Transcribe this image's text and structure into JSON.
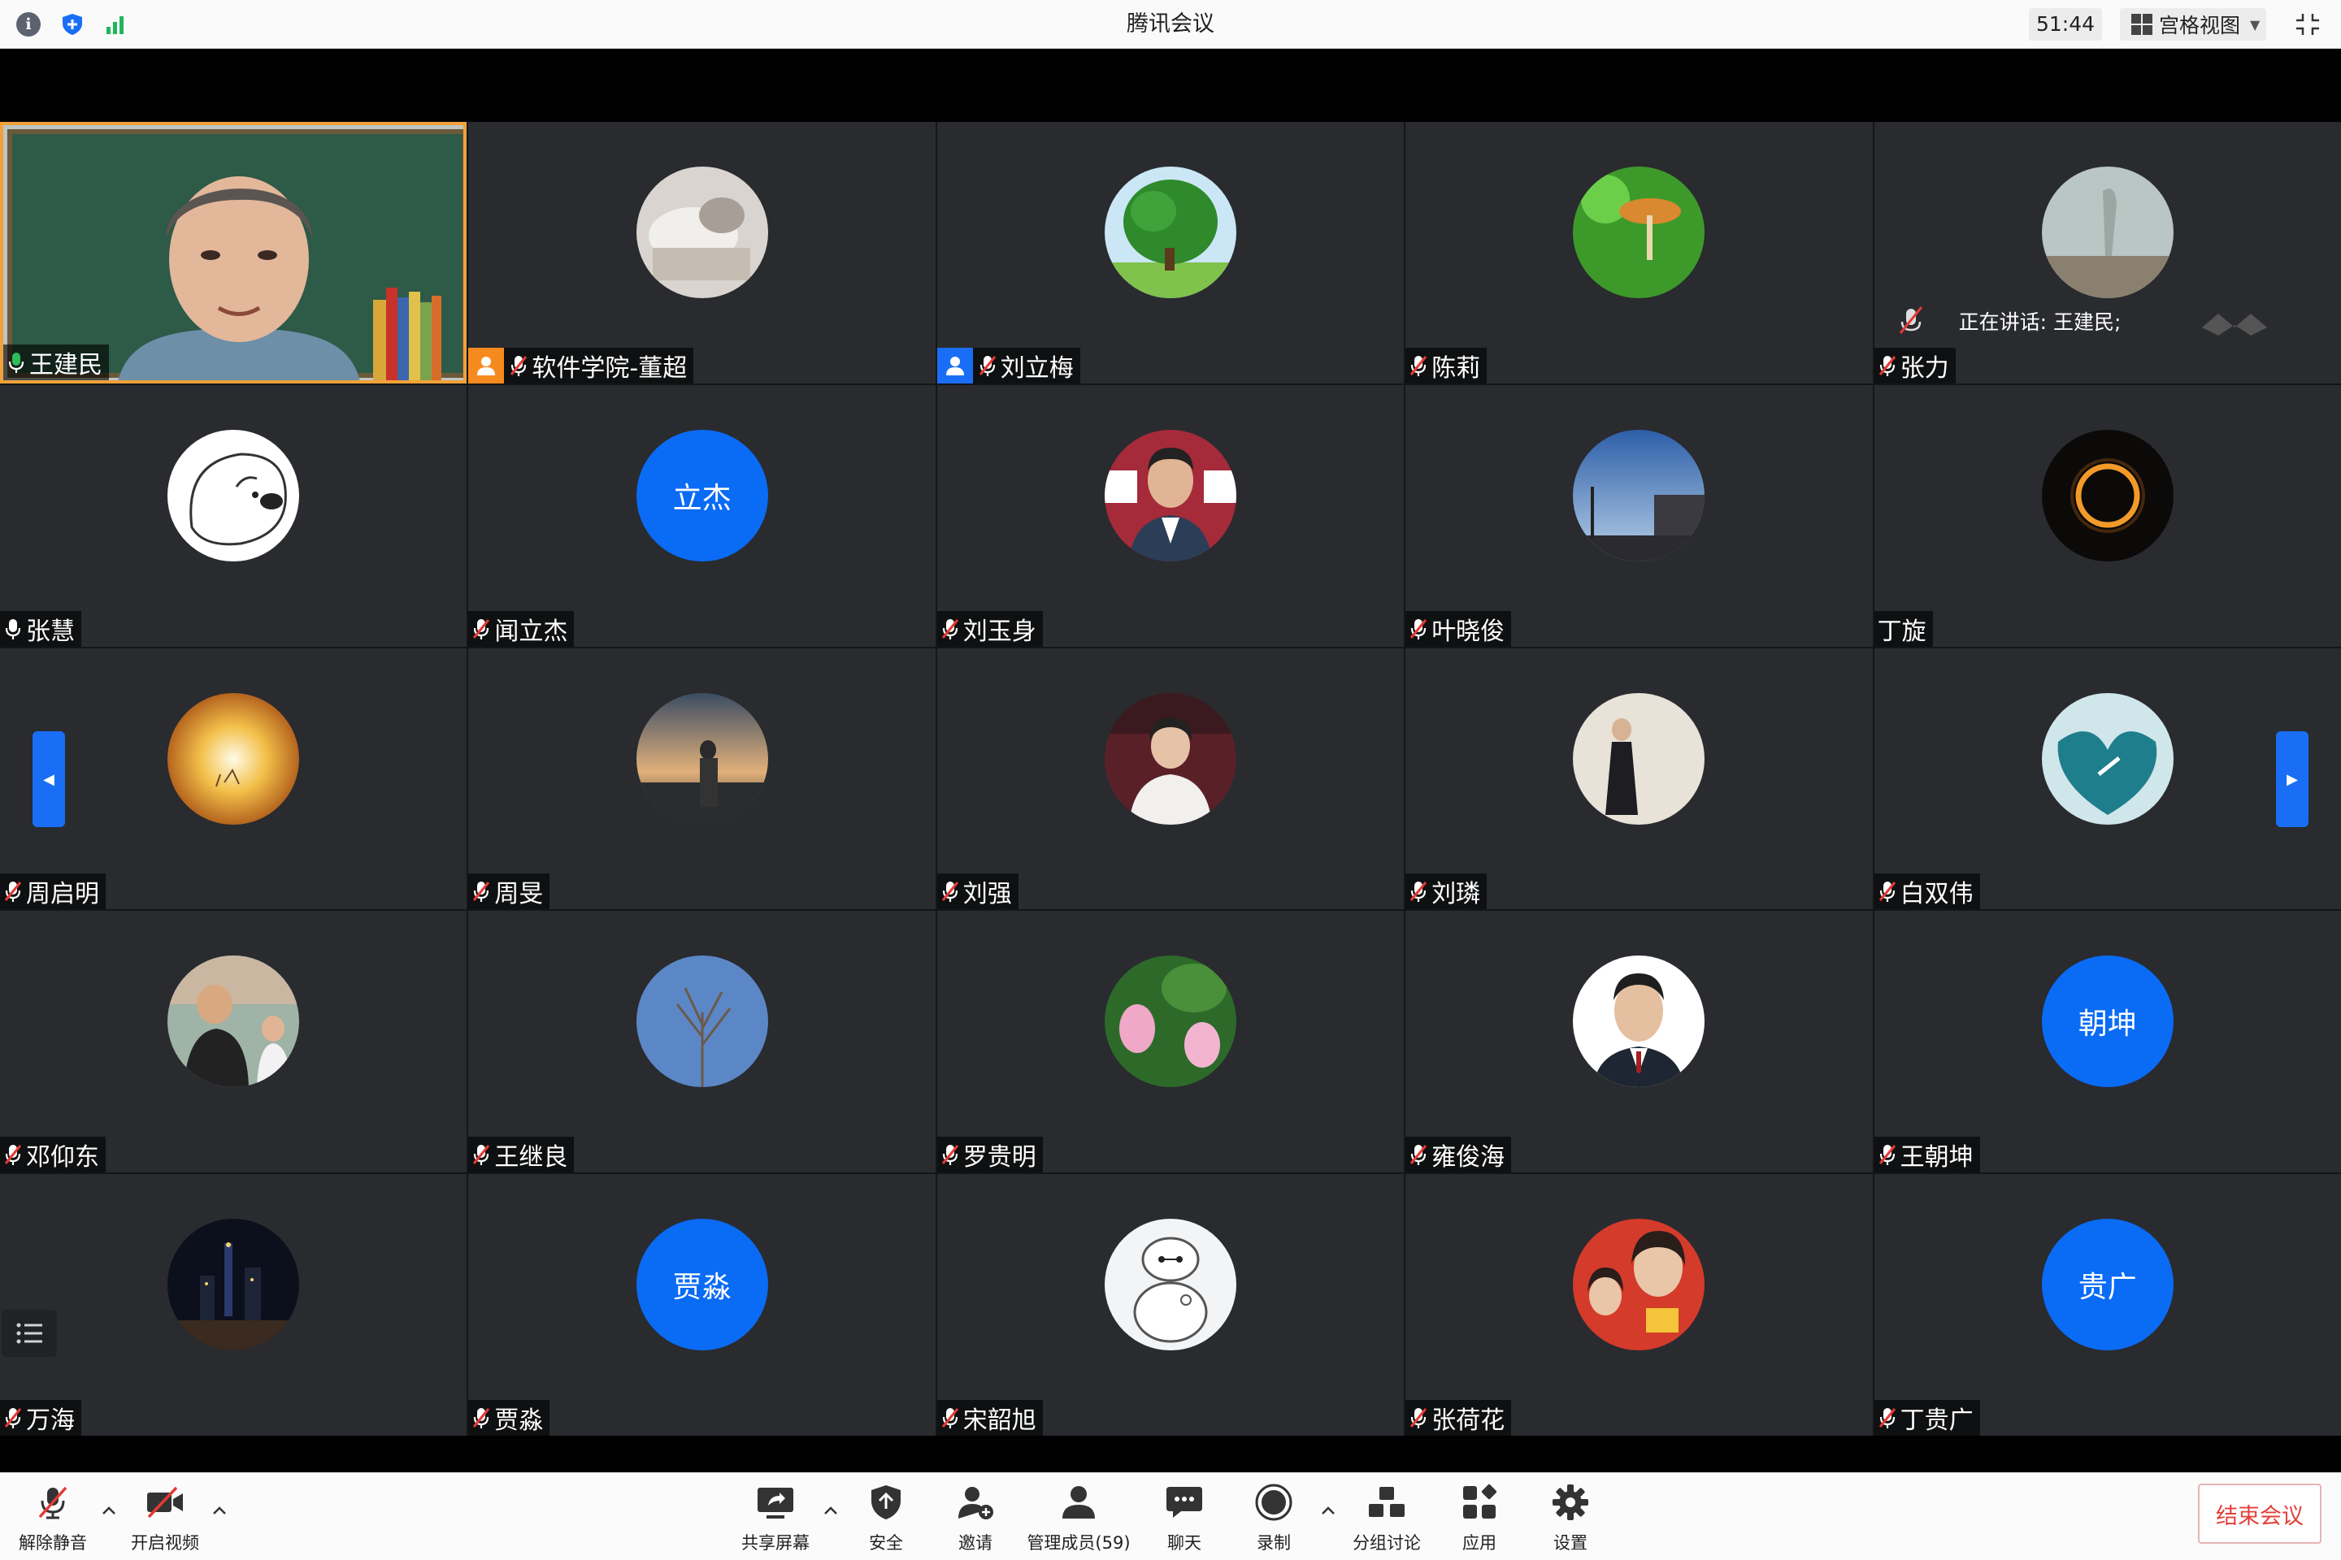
{
  "window": {
    "title": "腾讯会议",
    "timer": "51:44",
    "view_mode": "宫格视图"
  },
  "speaking": {
    "text": "正在讲话: 王建民;"
  },
  "participants": [
    {
      "name": "王建民",
      "mic": "on",
      "video": true
    },
    {
      "name": "软件学院-董超",
      "mic": "muted",
      "host": "orange",
      "avatar": "image"
    },
    {
      "name": "刘立梅",
      "mic": "muted",
      "host": "blue",
      "avatar": "image"
    },
    {
      "name": "陈莉",
      "mic": "muted",
      "avatar": "image"
    },
    {
      "name": "张力",
      "mic": "muted",
      "avatar": "image"
    },
    {
      "name": "张慧",
      "mic": "on",
      "avatar": "image"
    },
    {
      "name": "闻立杰",
      "mic": "muted",
      "avatar_text": "立杰"
    },
    {
      "name": "刘玉身",
      "mic": "muted",
      "avatar": "image"
    },
    {
      "name": "叶晓俊",
      "mic": "muted",
      "avatar": "image"
    },
    {
      "name": "丁旋",
      "mic": "none",
      "avatar": "image"
    },
    {
      "name": "周启明",
      "mic": "muted",
      "avatar": "image"
    },
    {
      "name": "周旻",
      "mic": "muted",
      "avatar": "image"
    },
    {
      "name": "刘强",
      "mic": "muted",
      "avatar": "image"
    },
    {
      "name": "刘璘",
      "mic": "muted",
      "avatar": "image"
    },
    {
      "name": "白双伟",
      "mic": "muted",
      "avatar": "image"
    },
    {
      "name": "邓仰东",
      "mic": "muted",
      "avatar": "image"
    },
    {
      "name": "王继良",
      "mic": "muted",
      "avatar": "image"
    },
    {
      "name": "罗贵明",
      "mic": "muted",
      "avatar": "image"
    },
    {
      "name": "雍俊海",
      "mic": "muted",
      "avatar": "image"
    },
    {
      "name": "王朝坤",
      "mic": "muted",
      "avatar_text": "朝坤"
    },
    {
      "name": "万海",
      "mic": "muted",
      "avatar": "image"
    },
    {
      "name": "贾淼",
      "mic": "muted",
      "avatar_text": "贾淼"
    },
    {
      "name": "宋韶旭",
      "mic": "muted",
      "avatar": "image"
    },
    {
      "name": "张荷花",
      "mic": "muted",
      "avatar": "image"
    },
    {
      "name": "丁贵广",
      "mic": "muted",
      "avatar_text": "贵广"
    }
  ],
  "toolbar": {
    "unmute": "解除静音",
    "start_video": "开启视频",
    "share_screen": "共享屏幕",
    "security": "安全",
    "invite": "邀请",
    "manage_members": "管理成员(59)",
    "chat": "聊天",
    "record": "录制",
    "breakout": "分组讨论",
    "apps": "应用",
    "settings": "设置",
    "end_meeting": "结束会议"
  },
  "colors": {
    "accent_blue": "#0a6bf5",
    "active_speaker_border": "#f0a23a",
    "end_meeting_red": "#e2413a",
    "tile_bg": "#292b2f"
  }
}
